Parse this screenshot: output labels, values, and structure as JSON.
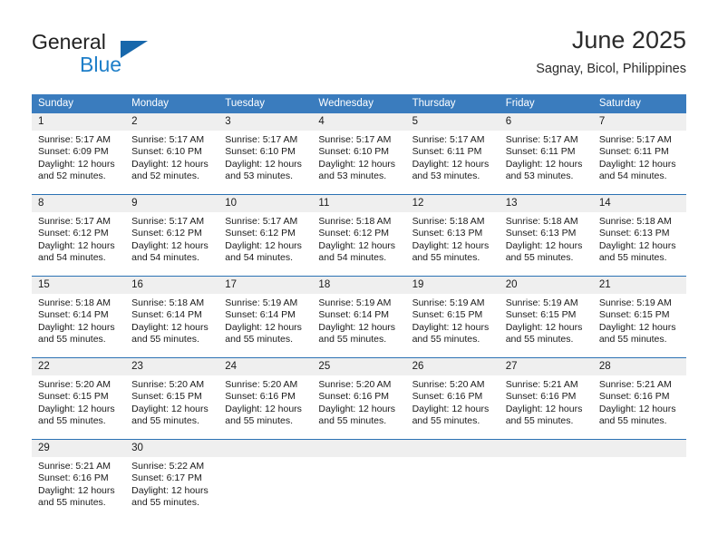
{
  "brand": {
    "name_part1": "General",
    "name_part2": "Blue",
    "mark": "triangle-logo-mark",
    "accent_color": "#1d7ec8"
  },
  "header": {
    "title": "June 2025",
    "subtitle": "Sagnay, Bicol, Philippines"
  },
  "colors": {
    "header_row_bg": "#3a7cbe",
    "row_separator": "#2c72b4",
    "daynum_band_bg": "#efefef",
    "text": "#1a1a1a"
  },
  "calendar": {
    "weekdays": [
      "Sunday",
      "Monday",
      "Tuesday",
      "Wednesday",
      "Thursday",
      "Friday",
      "Saturday"
    ],
    "weeks": [
      {
        "days": [
          {
            "num": "1",
            "sunrise": "Sunrise: 5:17 AM",
            "sunset": "Sunset: 6:09 PM",
            "daylight": "Daylight: 12 hours and 52 minutes."
          },
          {
            "num": "2",
            "sunrise": "Sunrise: 5:17 AM",
            "sunset": "Sunset: 6:10 PM",
            "daylight": "Daylight: 12 hours and 52 minutes."
          },
          {
            "num": "3",
            "sunrise": "Sunrise: 5:17 AM",
            "sunset": "Sunset: 6:10 PM",
            "daylight": "Daylight: 12 hours and 53 minutes."
          },
          {
            "num": "4",
            "sunrise": "Sunrise: 5:17 AM",
            "sunset": "Sunset: 6:10 PM",
            "daylight": "Daylight: 12 hours and 53 minutes."
          },
          {
            "num": "5",
            "sunrise": "Sunrise: 5:17 AM",
            "sunset": "Sunset: 6:11 PM",
            "daylight": "Daylight: 12 hours and 53 minutes."
          },
          {
            "num": "6",
            "sunrise": "Sunrise: 5:17 AM",
            "sunset": "Sunset: 6:11 PM",
            "daylight": "Daylight: 12 hours and 53 minutes."
          },
          {
            "num": "7",
            "sunrise": "Sunrise: 5:17 AM",
            "sunset": "Sunset: 6:11 PM",
            "daylight": "Daylight: 12 hours and 54 minutes."
          }
        ]
      },
      {
        "days": [
          {
            "num": "8",
            "sunrise": "Sunrise: 5:17 AM",
            "sunset": "Sunset: 6:12 PM",
            "daylight": "Daylight: 12 hours and 54 minutes."
          },
          {
            "num": "9",
            "sunrise": "Sunrise: 5:17 AM",
            "sunset": "Sunset: 6:12 PM",
            "daylight": "Daylight: 12 hours and 54 minutes."
          },
          {
            "num": "10",
            "sunrise": "Sunrise: 5:17 AM",
            "sunset": "Sunset: 6:12 PM",
            "daylight": "Daylight: 12 hours and 54 minutes."
          },
          {
            "num": "11",
            "sunrise": "Sunrise: 5:18 AM",
            "sunset": "Sunset: 6:12 PM",
            "daylight": "Daylight: 12 hours and 54 minutes."
          },
          {
            "num": "12",
            "sunrise": "Sunrise: 5:18 AM",
            "sunset": "Sunset: 6:13 PM",
            "daylight": "Daylight: 12 hours and 55 minutes."
          },
          {
            "num": "13",
            "sunrise": "Sunrise: 5:18 AM",
            "sunset": "Sunset: 6:13 PM",
            "daylight": "Daylight: 12 hours and 55 minutes."
          },
          {
            "num": "14",
            "sunrise": "Sunrise: 5:18 AM",
            "sunset": "Sunset: 6:13 PM",
            "daylight": "Daylight: 12 hours and 55 minutes."
          }
        ]
      },
      {
        "days": [
          {
            "num": "15",
            "sunrise": "Sunrise: 5:18 AM",
            "sunset": "Sunset: 6:14 PM",
            "daylight": "Daylight: 12 hours and 55 minutes."
          },
          {
            "num": "16",
            "sunrise": "Sunrise: 5:18 AM",
            "sunset": "Sunset: 6:14 PM",
            "daylight": "Daylight: 12 hours and 55 minutes."
          },
          {
            "num": "17",
            "sunrise": "Sunrise: 5:19 AM",
            "sunset": "Sunset: 6:14 PM",
            "daylight": "Daylight: 12 hours and 55 minutes."
          },
          {
            "num": "18",
            "sunrise": "Sunrise: 5:19 AM",
            "sunset": "Sunset: 6:14 PM",
            "daylight": "Daylight: 12 hours and 55 minutes."
          },
          {
            "num": "19",
            "sunrise": "Sunrise: 5:19 AM",
            "sunset": "Sunset: 6:15 PM",
            "daylight": "Daylight: 12 hours and 55 minutes."
          },
          {
            "num": "20",
            "sunrise": "Sunrise: 5:19 AM",
            "sunset": "Sunset: 6:15 PM",
            "daylight": "Daylight: 12 hours and 55 minutes."
          },
          {
            "num": "21",
            "sunrise": "Sunrise: 5:19 AM",
            "sunset": "Sunset: 6:15 PM",
            "daylight": "Daylight: 12 hours and 55 minutes."
          }
        ]
      },
      {
        "days": [
          {
            "num": "22",
            "sunrise": "Sunrise: 5:20 AM",
            "sunset": "Sunset: 6:15 PM",
            "daylight": "Daylight: 12 hours and 55 minutes."
          },
          {
            "num": "23",
            "sunrise": "Sunrise: 5:20 AM",
            "sunset": "Sunset: 6:15 PM",
            "daylight": "Daylight: 12 hours and 55 minutes."
          },
          {
            "num": "24",
            "sunrise": "Sunrise: 5:20 AM",
            "sunset": "Sunset: 6:16 PM",
            "daylight": "Daylight: 12 hours and 55 minutes."
          },
          {
            "num": "25",
            "sunrise": "Sunrise: 5:20 AM",
            "sunset": "Sunset: 6:16 PM",
            "daylight": "Daylight: 12 hours and 55 minutes."
          },
          {
            "num": "26",
            "sunrise": "Sunrise: 5:20 AM",
            "sunset": "Sunset: 6:16 PM",
            "daylight": "Daylight: 12 hours and 55 minutes."
          },
          {
            "num": "27",
            "sunrise": "Sunrise: 5:21 AM",
            "sunset": "Sunset: 6:16 PM",
            "daylight": "Daylight: 12 hours and 55 minutes."
          },
          {
            "num": "28",
            "sunrise": "Sunrise: 5:21 AM",
            "sunset": "Sunset: 6:16 PM",
            "daylight": "Daylight: 12 hours and 55 minutes."
          }
        ]
      },
      {
        "days": [
          {
            "num": "29",
            "sunrise": "Sunrise: 5:21 AM",
            "sunset": "Sunset: 6:16 PM",
            "daylight": "Daylight: 12 hours and 55 minutes."
          },
          {
            "num": "30",
            "sunrise": "Sunrise: 5:22 AM",
            "sunset": "Sunset: 6:17 PM",
            "daylight": "Daylight: 12 hours and 55 minutes."
          },
          {
            "num": "",
            "sunrise": "",
            "sunset": "",
            "daylight": ""
          },
          {
            "num": "",
            "sunrise": "",
            "sunset": "",
            "daylight": ""
          },
          {
            "num": "",
            "sunrise": "",
            "sunset": "",
            "daylight": ""
          },
          {
            "num": "",
            "sunrise": "",
            "sunset": "",
            "daylight": ""
          },
          {
            "num": "",
            "sunrise": "",
            "sunset": "",
            "daylight": ""
          }
        ]
      }
    ]
  }
}
